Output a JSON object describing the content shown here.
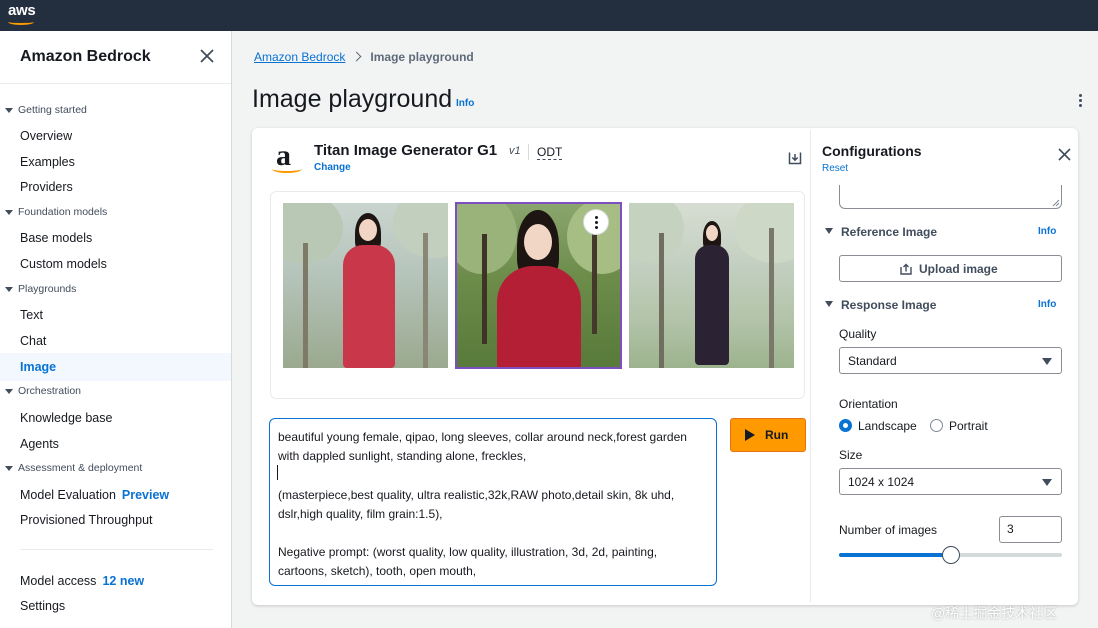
{
  "topbar": {
    "logo_text": "aws",
    "colors": {
      "bg": "#232f3e",
      "accent": "#ff9900"
    }
  },
  "sidebar": {
    "title": "Amazon Bedrock",
    "sections": [
      {
        "label": "Getting started",
        "items": [
          {
            "label": "Overview"
          },
          {
            "label": "Examples"
          },
          {
            "label": "Providers"
          }
        ]
      },
      {
        "label": "Foundation models",
        "items": [
          {
            "label": "Base models"
          },
          {
            "label": "Custom models"
          }
        ]
      },
      {
        "label": "Playgrounds",
        "items": [
          {
            "label": "Text"
          },
          {
            "label": "Chat"
          },
          {
            "label": "Image",
            "active": true
          }
        ]
      },
      {
        "label": "Orchestration",
        "items": [
          {
            "label": "Knowledge base"
          },
          {
            "label": "Agents"
          }
        ]
      },
      {
        "label": "Assessment & deployment",
        "items": [
          {
            "label": "Model Evaluation",
            "badge": "Preview"
          },
          {
            "label": "Provisioned Throughput"
          }
        ]
      }
    ],
    "footer": [
      {
        "label": "Model access",
        "badge": "12 new"
      },
      {
        "label": "Settings"
      }
    ]
  },
  "breadcrumb": {
    "root": "Amazon Bedrock",
    "current": "Image playground"
  },
  "page": {
    "title": "Image playground",
    "info": "Info"
  },
  "model": {
    "name": "Titan Image Generator G1",
    "version": "v1",
    "tag": "ODT",
    "change_label": "Change"
  },
  "images": [
    {
      "icon": "generated-image",
      "selected": false
    },
    {
      "icon": "generated-image",
      "selected": true
    },
    {
      "icon": "generated-image",
      "selected": false
    }
  ],
  "prompt": {
    "line1": "beautiful young female, qipao, long sleeves, collar around neck,forest garden with dappled sunlight, standing alone, freckles,",
    "line2": "(masterpiece,best quality, ultra realistic,32k,RAW photo,detail skin, 8k uhd, dslr,high quality, film grain:1.5),",
    "line3": "Negative prompt: (worst quality, low quality, illustration, 3d, 2d, painting, cartoons, sketch), tooth, open mouth,"
  },
  "run_label": "Run",
  "config": {
    "title": "Configurations",
    "reset": "Reset",
    "reference": {
      "title": "Reference Image",
      "info": "Info",
      "upload_label": "Upload image"
    },
    "response": {
      "title": "Response Image",
      "info": "Info"
    },
    "quality": {
      "label": "Quality",
      "value": "Standard"
    },
    "orientation": {
      "label": "Orientation",
      "options": [
        "Landscape",
        "Portrait"
      ],
      "selected": "Landscape"
    },
    "size": {
      "label": "Size",
      "value": "1024 x 1024"
    },
    "num_images": {
      "label": "Number of images",
      "value": "3",
      "slider_fraction": 0.5
    }
  },
  "watermark": "@稀土掘金技术社区"
}
